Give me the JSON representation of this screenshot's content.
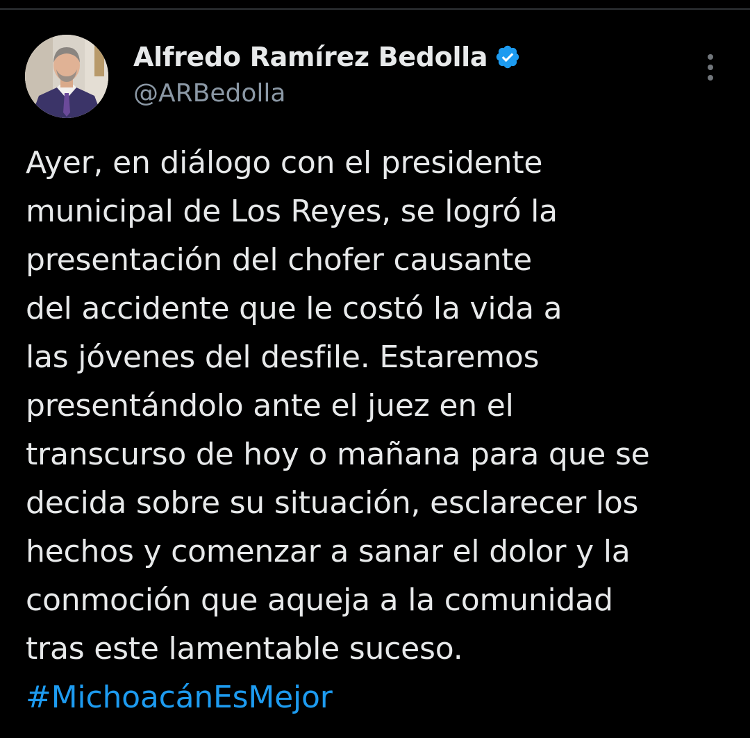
{
  "author": {
    "display_name": "Alfredo Ramírez Bedolla",
    "handle": "@ARBedolla",
    "verified": true,
    "verified_color": "#1d9bf0"
  },
  "menu": {
    "icon": "more-vertical-icon"
  },
  "tweet": {
    "lines": [
      "Ayer, en diálogo con el presidente",
      "municipal de Los Reyes, se logró la",
      "presentación del chofer causante",
      "del accidente que le costó la vida a",
      "las jóvenes del desfile. Estaremos",
      "presentándolo ante el juez en el",
      "transcurso de hoy o mañana para que se",
      "decida sobre su situación, esclarecer los",
      "hechos y comenzar a sanar el dolor y la",
      "conmoción que aqueja a la comunidad",
      "tras este lamentable suceso."
    ],
    "hashtag": "#MichoacánEsMejor"
  },
  "colors": {
    "background": "#000000",
    "text": "#e7e9ea",
    "secondary": "#8b98a5",
    "link": "#1d9bf0"
  }
}
